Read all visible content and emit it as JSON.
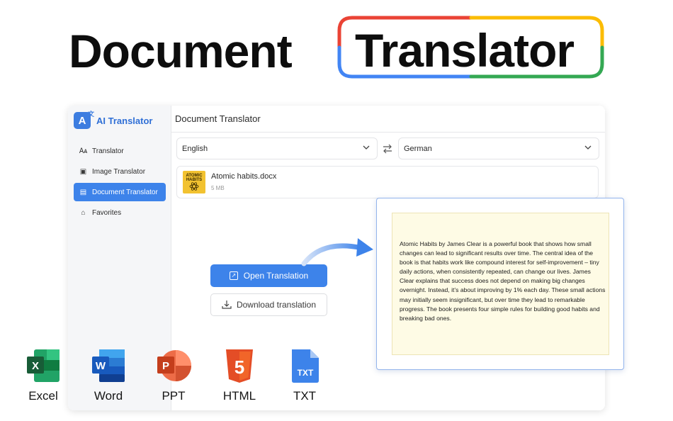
{
  "hero": {
    "word1": "Document",
    "word2": "Translator",
    "frame_colors": [
      "#ea4335",
      "#fbbc05",
      "#4285f4",
      "#34a853"
    ]
  },
  "app": {
    "brand_name": "AI Translator",
    "header_title": "Document Translator",
    "nav": [
      {
        "label": "Translator",
        "icon": "translate-icon",
        "active": false
      },
      {
        "label": "Image Translator",
        "icon": "image-translate-icon",
        "active": false
      },
      {
        "label": "Document Translator",
        "icon": "document-translate-icon",
        "active": true
      },
      {
        "label": "Favorites",
        "icon": "favorites-icon",
        "active": false
      }
    ],
    "source_language": "English",
    "target_language": "German",
    "file": {
      "name": "Atomic habits.docx",
      "size": "5 MB",
      "thumb_text": [
        "ATOMIC",
        "HABITS"
      ]
    },
    "open_button": "Open Translation",
    "download_button": "Download translation",
    "accent": "#3d83ea"
  },
  "popup": {
    "text": "Atomic Habits by James Clear is a powerful book that shows how small changes can lead to significant results over time. The central idea of the book is that habits work like compound interest for self-improvement – tiny daily actions, when consistently repeated, can change our lives. James Clear explains that success does not depend on making big changes overnight. Instead, it’s about improving by 1% each day. These small actions may initially seem insignificant, but over time they lead to remarkable progress. The book presents four simple rules for building good habits and breaking bad ones."
  },
  "formats": [
    {
      "label": "Excel",
      "icon": "excel-icon",
      "letter": "X",
      "color": "#1f7a45"
    },
    {
      "label": "Word",
      "icon": "word-icon",
      "letter": "W",
      "color": "#2b5fb4"
    },
    {
      "label": "PPT",
      "icon": "ppt-icon",
      "letter": "P",
      "color": "#c9462c"
    },
    {
      "label": "HTML",
      "icon": "html-icon",
      "letter": "5",
      "color": "#e4562b"
    },
    {
      "label": "TXT",
      "icon": "txt-icon",
      "letter": "TXT",
      "color": "#3d83ea"
    }
  ]
}
